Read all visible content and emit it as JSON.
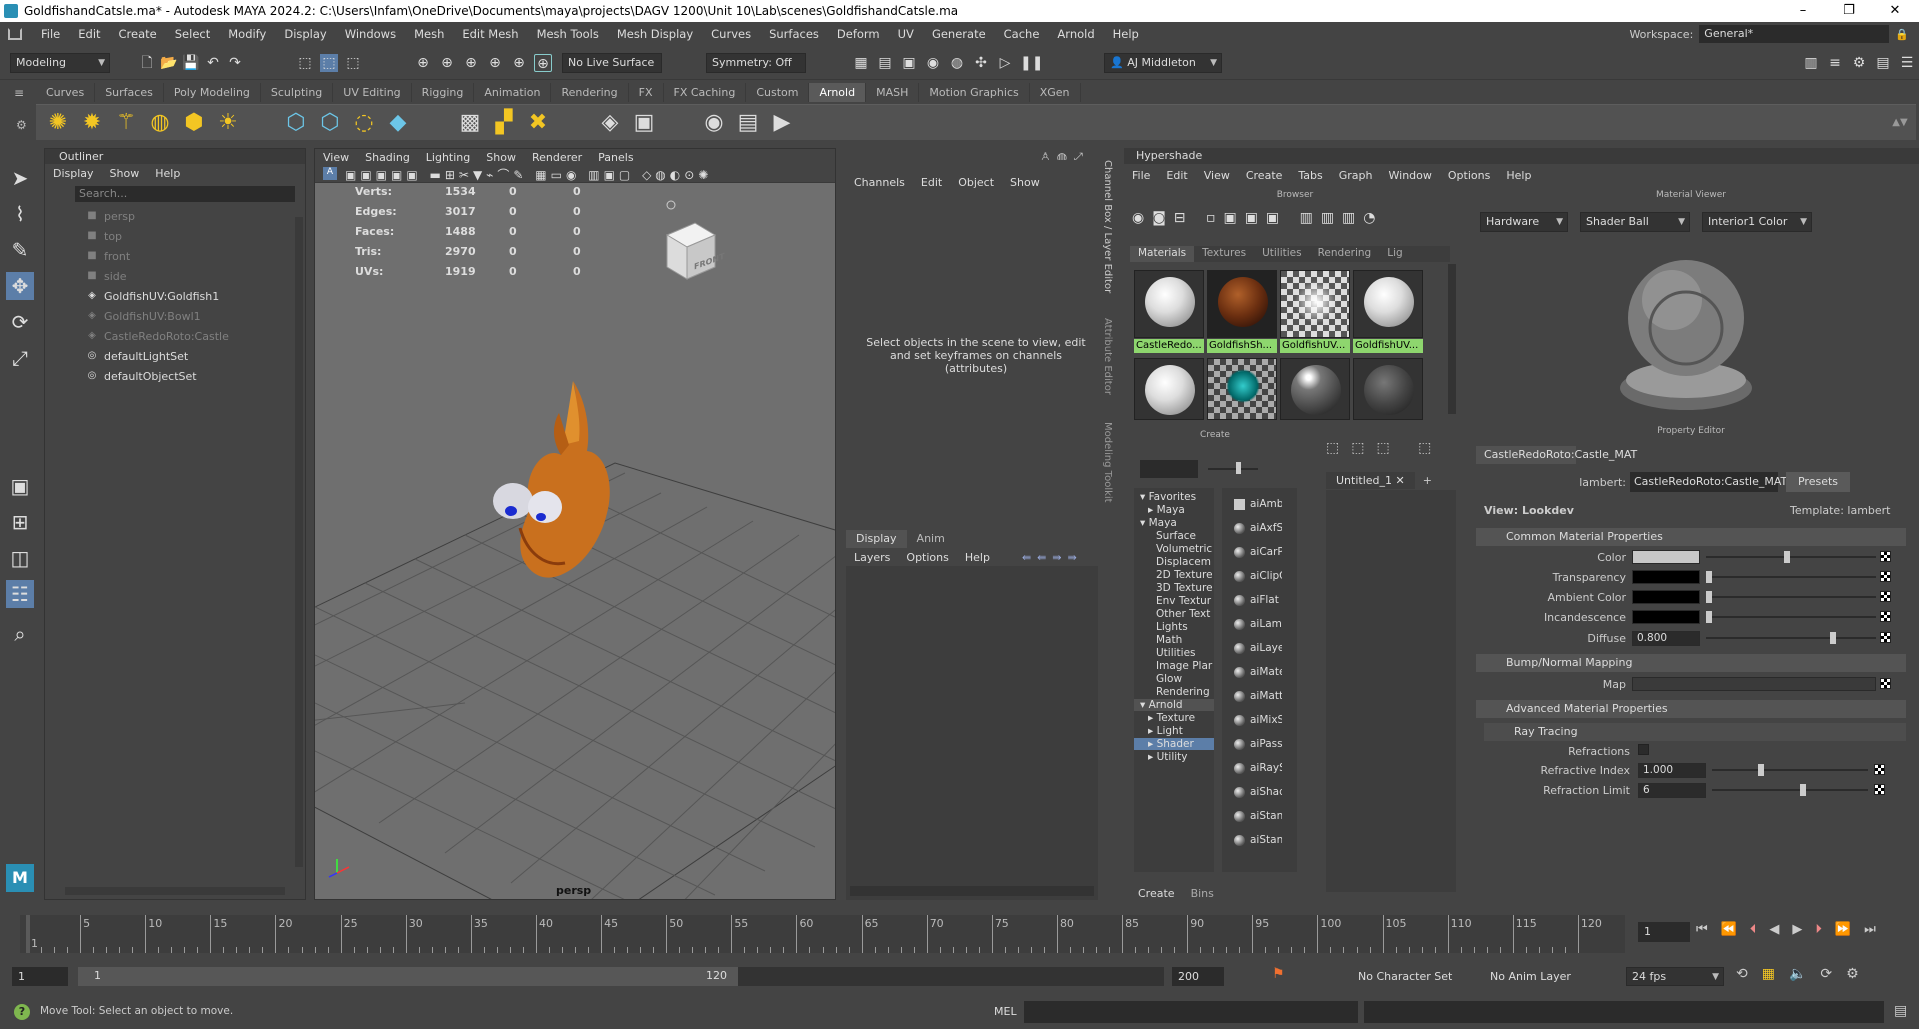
{
  "title_bar": {
    "text": "GoldfishandCatsle.ma* - Autodesk MAYA 2024.2: C:\\Users\\Infam\\OneDrive\\Documents\\maya\\projects\\DAGV 1200\\Unit 10\\Lab\\scenes\\GoldfishandCatsle.ma"
  },
  "menubar": {
    "items": [
      "File",
      "Edit",
      "Create",
      "Select",
      "Modify",
      "Display",
      "Windows",
      "Mesh",
      "Edit Mesh",
      "Mesh Tools",
      "Mesh Display",
      "Curves",
      "Surfaces",
      "Deform",
      "UV",
      "Generate",
      "Cache",
      "Arnold",
      "Help"
    ]
  },
  "workspace": {
    "label": "Workspace:",
    "value": "General*"
  },
  "statusline": {
    "menuset": "Modeling",
    "live_surface": "No Live Surface",
    "symmetry": "Symmetry: Off",
    "user": "AJ Middleton"
  },
  "shelf": {
    "tabs": [
      "Curves",
      "Surfaces",
      "Poly Modeling",
      "Sculpting",
      "UV Editing",
      "Rigging",
      "Animation",
      "Rendering",
      "FX",
      "FX Caching",
      "Custom",
      "Arnold",
      "MASH",
      "Motion Graphics",
      "XGen"
    ],
    "active": "Arnold"
  },
  "outliner": {
    "title": "Outliner",
    "menu": [
      "Display",
      "Show",
      "Help"
    ],
    "search_placeholder": "Search...",
    "items": [
      {
        "label": "persp",
        "icon": "camera-icon",
        "dim": true
      },
      {
        "label": "top",
        "icon": "camera-icon",
        "dim": true
      },
      {
        "label": "front",
        "icon": "camera-icon",
        "dim": true
      },
      {
        "label": "side",
        "icon": "camera-icon",
        "dim": true
      },
      {
        "label": "GoldfishUV:Goldfish1",
        "icon": "transform-icon",
        "dim": false
      },
      {
        "label": "GoldfishUV:Bowl1",
        "icon": "transform-icon",
        "dim": true
      },
      {
        "label": "CastleRedoRoto:Castle",
        "icon": "transform-icon",
        "dim": true
      },
      {
        "label": "defaultLightSet",
        "icon": "set-icon",
        "dim": false
      },
      {
        "label": "defaultObjectSet",
        "icon": "set-icon",
        "dim": false
      }
    ]
  },
  "viewport": {
    "menu": [
      "View",
      "Shading",
      "Lighting",
      "Show",
      "Renderer",
      "Panels"
    ],
    "hud": [
      {
        "label": "Verts:",
        "v1": "1534",
        "v2": "0",
        "v3": "0"
      },
      {
        "label": "Edges:",
        "v1": "3017",
        "v2": "0",
        "v3": "0"
      },
      {
        "label": "Faces:",
        "v1": "1488",
        "v2": "0",
        "v3": "0"
      },
      {
        "label": "Tris:",
        "v1": "2970",
        "v2": "0",
        "v3": "0"
      },
      {
        "label": "UVs:",
        "v1": "1919",
        "v2": "0",
        "v3": "0"
      }
    ],
    "camera_label": "persp",
    "viewcube_label": "FRONT"
  },
  "channel_box": {
    "menu": [
      "Channels",
      "Edit",
      "Object",
      "Show"
    ],
    "message": "Select objects in the scene to view, edit and set keyframes on channels (attributes)",
    "layer_tabs": [
      "Display",
      "Anim"
    ],
    "layer_menu": [
      "Layers",
      "Options",
      "Help"
    ]
  },
  "side_tabs": [
    "Channel Box / Layer Editor",
    "Attribute Editor",
    "Modeling Toolkit"
  ],
  "hypershade": {
    "title": "Hypershade",
    "menu": [
      "File",
      "Edit",
      "View",
      "Create",
      "Tabs",
      "Graph",
      "Window",
      "Options",
      "Help"
    ],
    "browser_label": "Browser",
    "browser_tabs": [
      "Materials",
      "Textures",
      "Utilities",
      "Rendering",
      "Lig"
    ],
    "swatches": [
      {
        "label": "CastleRedo...",
        "kind": "white"
      },
      {
        "label": "GoldfishSh...",
        "kind": "copper"
      },
      {
        "label": "GoldfishUV...",
        "kind": "checker"
      },
      {
        "label": "GoldfishUV...",
        "kind": "white"
      },
      {
        "label": "",
        "kind": "white"
      },
      {
        "label": "",
        "kind": "checker-teal"
      },
      {
        "label": "",
        "kind": "glossy"
      },
      {
        "label": "",
        "kind": "dark"
      }
    ],
    "create_label": "Create",
    "create_tree": [
      "Favorites",
      "Maya",
      "Maya",
      "Surface",
      "Volumetric",
      "Displacem",
      "2D Texture",
      "3D Texture",
      "Env Textur",
      "Other Text",
      "Lights",
      "Math",
      "Utilities",
      "Image Plar",
      "Glow",
      "Rendering",
      "Arnold",
      "Texture",
      "Light",
      "Shader",
      "Utility"
    ],
    "create_nodes": [
      "aiAmbie",
      "aiAxfSh",
      "aiCarPa",
      "aiClipG",
      "aiFlat",
      "aiLambe",
      "aiLayerS",
      "aiMater",
      "aiMatte",
      "aiMixSh",
      "aiPassth",
      "aiRaySw",
      "aiShado",
      "aiStand",
      "aiStand"
    ],
    "graph_tab": "Untitled_1",
    "bottom_tabs": [
      "Create",
      "Bins"
    ],
    "material_viewer": {
      "title": "Material Viewer",
      "renderer": "Hardware",
      "shape": "Shader Ball",
      "env": "Interior1 Color"
    },
    "property_editor": {
      "title": "Property Editor",
      "node": "CastleRedoRoto:Castle_MAT",
      "type_label": "lambert:",
      "type_value": "CastleRedoRoto:Castle_MAT",
      "presets": "Presets",
      "view": "View: Lookdev",
      "template": "Template: lambert",
      "sections": {
        "common": "Common Material Properties",
        "bump": "Bump/Normal Mapping",
        "advanced": "Advanced Material Properties",
        "ray": "Ray Tracing"
      },
      "attrs": {
        "color": "Color",
        "transparency": "Transparency",
        "ambient": "Ambient Color",
        "incandescence": "Incandescence",
        "diffuse": "Diffuse",
        "diffuse_value": "0.800",
        "map": "Map",
        "refractions": "Refractions",
        "ref_index": "Refractive Index",
        "ref_index_value": "1.000",
        "ref_limit": "Refraction Limit",
        "ref_limit_value": "6"
      }
    }
  },
  "timeline": {
    "ticks": [
      "1",
      "5",
      "10",
      "15",
      "20",
      "25",
      "30",
      "35",
      "40",
      "45",
      "50",
      "55",
      "60",
      "65",
      "70",
      "75",
      "80",
      "85",
      "90",
      "95",
      "100",
      "105",
      "110",
      "115",
      "120"
    ],
    "current_frame": "1",
    "range_start": "1",
    "range_inner_start": "1",
    "range_inner_end": "120",
    "range_end": "200",
    "char_set": "No Character Set",
    "anim_layer": "No Anim Layer",
    "fps": "24 fps"
  },
  "command_line": {
    "help": "Move Tool: Select an object to move.",
    "mel": "MEL"
  }
}
